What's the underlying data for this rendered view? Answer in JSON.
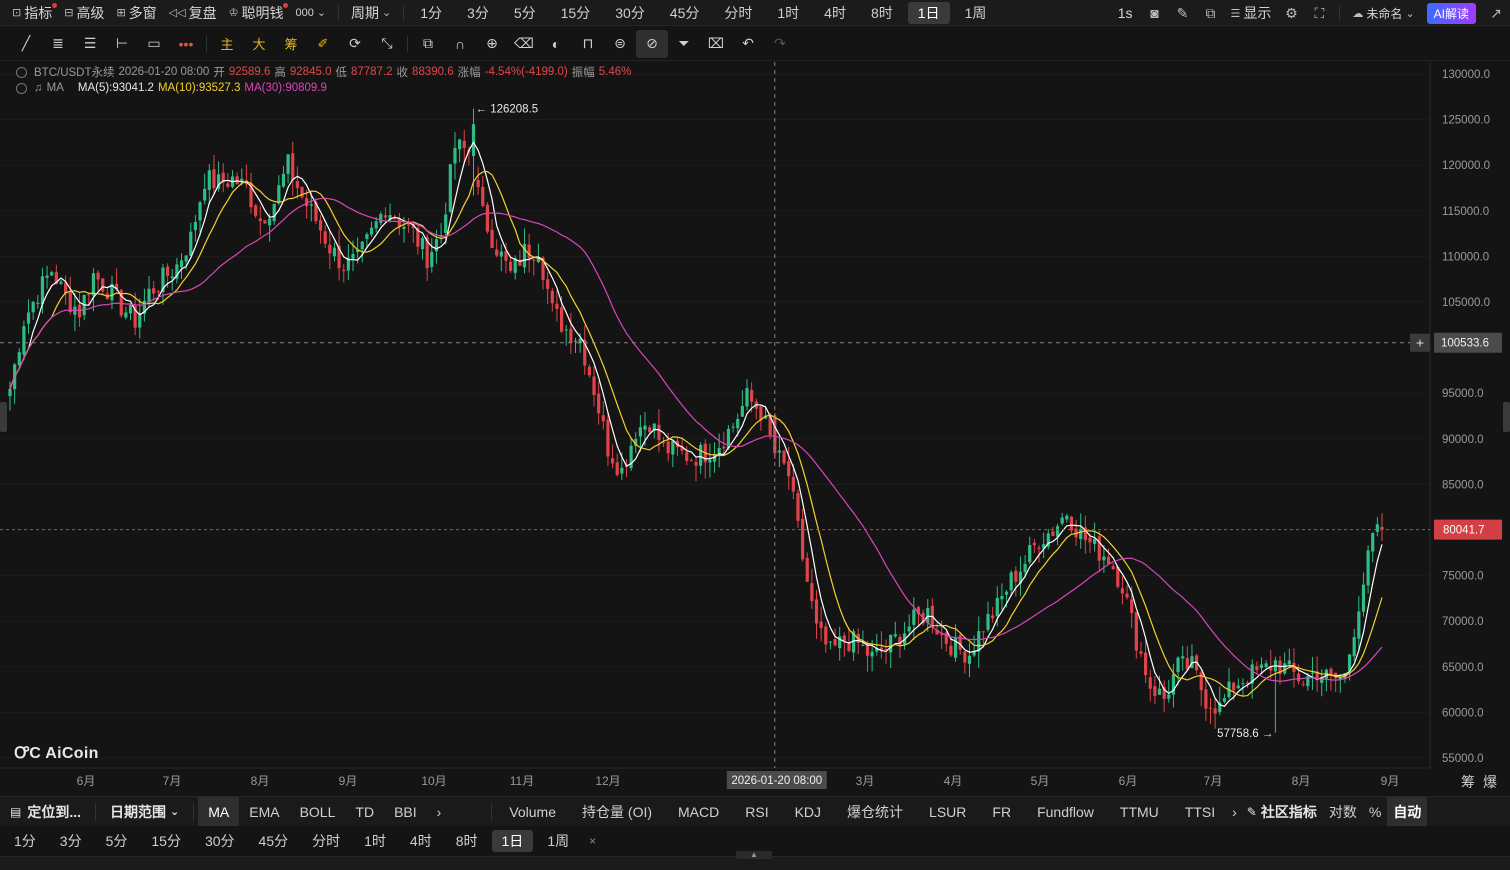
{
  "topbar": {
    "indicator": "指标",
    "advanced": "高级",
    "multiwindow": "多窗",
    "replay": "复盘",
    "smart_money": "聪明钱",
    "ext": "000",
    "period_menu": "周期",
    "periods": [
      "1分",
      "3分",
      "5分",
      "15分",
      "30分",
      "45分",
      "分时",
      "1时",
      "4时",
      "8时",
      "1日",
      "1周"
    ],
    "active_period": "1日",
    "interval": "1s",
    "display": "显示",
    "layout_name": "未命名",
    "ai_read": "AI解读"
  },
  "drawtools": {
    "main_label": "主",
    "big_label": "大",
    "chip_label": "筹"
  },
  "info": {
    "symbol": "BTC/USDT永续",
    "datetime": "2026-01-20 08:00",
    "open_label": "开",
    "open": "92589.6",
    "high_label": "高",
    "high": "92845.0",
    "low_label": "低",
    "low": "87787.2",
    "close_label": "收",
    "close": "88390.6",
    "change_label": "涨幅",
    "change": "-4.54%(-4199.0)",
    "amplitude_label": "振幅",
    "amplitude": "5.46%",
    "ma_name": "MA",
    "ma5": "MA(5):93041.2",
    "ma10": "MA(10):93527.3",
    "ma30": "MA(30):90809.9"
  },
  "chart_data": {
    "type": "candlestick",
    "y_ticks": [
      130000.0,
      125000.0,
      120000.0,
      115000.0,
      110000.0,
      105000.0,
      95000.0,
      90000.0,
      85000.0,
      75000.0,
      70000.0,
      65000.0,
      60000.0,
      55000.0
    ],
    "ylim": [
      55000,
      130000
    ],
    "x_ticks": [
      "6月",
      "7月",
      "8月",
      "9月",
      "10月",
      "11月",
      "12月",
      "3月",
      "4月",
      "5月",
      "6月",
      "7月",
      "8月",
      "9月"
    ],
    "crosshair_price": "100533.6",
    "crosshair_time": "2026-01-20 08:00",
    "last_price": "80041.7",
    "max_label": "126208.5",
    "min_label": "57758.6",
    "close_path": [
      [
        0,
        95500
      ],
      [
        3,
        103000
      ],
      [
        6,
        106000
      ],
      [
        9,
        108500
      ],
      [
        12,
        105500
      ],
      [
        15,
        104000
      ],
      [
        18,
        108000
      ],
      [
        21,
        106500
      ],
      [
        24,
        104500
      ],
      [
        27,
        103000
      ],
      [
        30,
        106000
      ],
      [
        33,
        107500
      ],
      [
        36,
        109000
      ],
      [
        39,
        112000
      ],
      [
        42,
        118500
      ],
      [
        45,
        118000
      ],
      [
        48,
        118500
      ],
      [
        51,
        117500
      ],
      [
        54,
        114000
      ],
      [
        57,
        116000
      ],
      [
        60,
        120000
      ],
      [
        63,
        116500
      ],
      [
        66,
        114000
      ],
      [
        69,
        111000
      ],
      [
        72,
        109000
      ],
      [
        75,
        109500
      ],
      [
        78,
        112500
      ],
      [
        81,
        115500
      ],
      [
        84,
        114000
      ],
      [
        87,
        112500
      ],
      [
        90,
        110000
      ],
      [
        93,
        112500
      ],
      [
        96,
        122000
      ],
      [
        99,
        121500
      ],
      [
        102,
        114500
      ],
      [
        105,
        111000
      ],
      [
        108,
        108000
      ],
      [
        111,
        110500
      ],
      [
        114,
        111000
      ],
      [
        117,
        104000
      ],
      [
        120,
        102000
      ],
      [
        123,
        101000
      ],
      [
        126,
        95500
      ],
      [
        129,
        89000
      ],
      [
        132,
        86500
      ],
      [
        135,
        91000
      ],
      [
        138,
        92000
      ],
      [
        141,
        89000
      ],
      [
        144,
        88500
      ],
      [
        147,
        88000
      ],
      [
        150,
        88500
      ],
      [
        153,
        89500
      ],
      [
        156,
        91500
      ],
      [
        159,
        94500
      ],
      [
        162,
        93000
      ],
      [
        165,
        88500
      ],
      [
        168,
        86000
      ],
      [
        171,
        77000
      ],
      [
        174,
        69000
      ],
      [
        177,
        66500
      ],
      [
        180,
        68000
      ],
      [
        183,
        67500
      ],
      [
        186,
        66000
      ],
      [
        189,
        67000
      ],
      [
        192,
        68500
      ],
      [
        195,
        70000
      ],
      [
        198,
        71000
      ],
      [
        201,
        68500
      ],
      [
        204,
        67000
      ],
      [
        207,
        66500
      ],
      [
        210,
        69500
      ],
      [
        213,
        71500
      ],
      [
        216,
        74500
      ],
      [
        219,
        76500
      ],
      [
        222,
        79000
      ],
      [
        225,
        80000
      ],
      [
        228,
        82000
      ],
      [
        231,
        79500
      ],
      [
        234,
        78000
      ],
      [
        237,
        77000
      ],
      [
        240,
        74000
      ],
      [
        243,
        68000
      ],
      [
        246,
        63000
      ],
      [
        249,
        61500
      ],
      [
        252,
        65000
      ],
      [
        255,
        65000
      ],
      [
        258,
        61500
      ],
      [
        261,
        60500
      ],
      [
        264,
        63000
      ],
      [
        267,
        64000
      ],
      [
        270,
        64500
      ],
      [
        273,
        65500
      ],
      [
        276,
        64500
      ],
      [
        279,
        63500
      ],
      [
        282,
        64500
      ],
      [
        285,
        63500
      ],
      [
        288,
        64000
      ],
      [
        291,
        72000
      ],
      [
        294,
        79000
      ],
      [
        296,
        80041.7
      ]
    ]
  },
  "bottom": {
    "locate": "定位到...",
    "date_range": "日期范围",
    "main_indicators": [
      "MA",
      "EMA",
      "BOLL",
      "TD",
      "BBI"
    ],
    "active_main": "MA",
    "sub_indicators": [
      "Volume",
      "持仓量 (OI)",
      "MACD",
      "RSI",
      "KDJ",
      "爆仓统计",
      "LSUR",
      "FR",
      "Fundflow",
      "TTMU",
      "TTSI"
    ],
    "community": "社区指标",
    "log_scale": "对数",
    "percent": "%",
    "auto": "自动",
    "periods": [
      "1分",
      "3分",
      "5分",
      "15分",
      "30分",
      "45分",
      "分时",
      "1时",
      "4时",
      "8时",
      "1日",
      "1周"
    ],
    "active_period": "1日",
    "close_x": "×"
  },
  "brand": "AiCoin",
  "colors": {
    "up": "#2ebd85",
    "down": "#e04349",
    "ma5": "#ffffff",
    "ma10": "#f2d22e",
    "ma30": "#d946b8",
    "last_price_tag": "#d23f44"
  },
  "icons": [
    "chart-icon",
    "advanced-icon",
    "multiwindow-icon",
    "replay-icon",
    "smart-money-icon",
    "camera-icon",
    "pen-icon",
    "popout-icon",
    "display-icon",
    "settings-icon",
    "fullscreen-icon",
    "cloud-icon",
    "share-icon"
  ]
}
